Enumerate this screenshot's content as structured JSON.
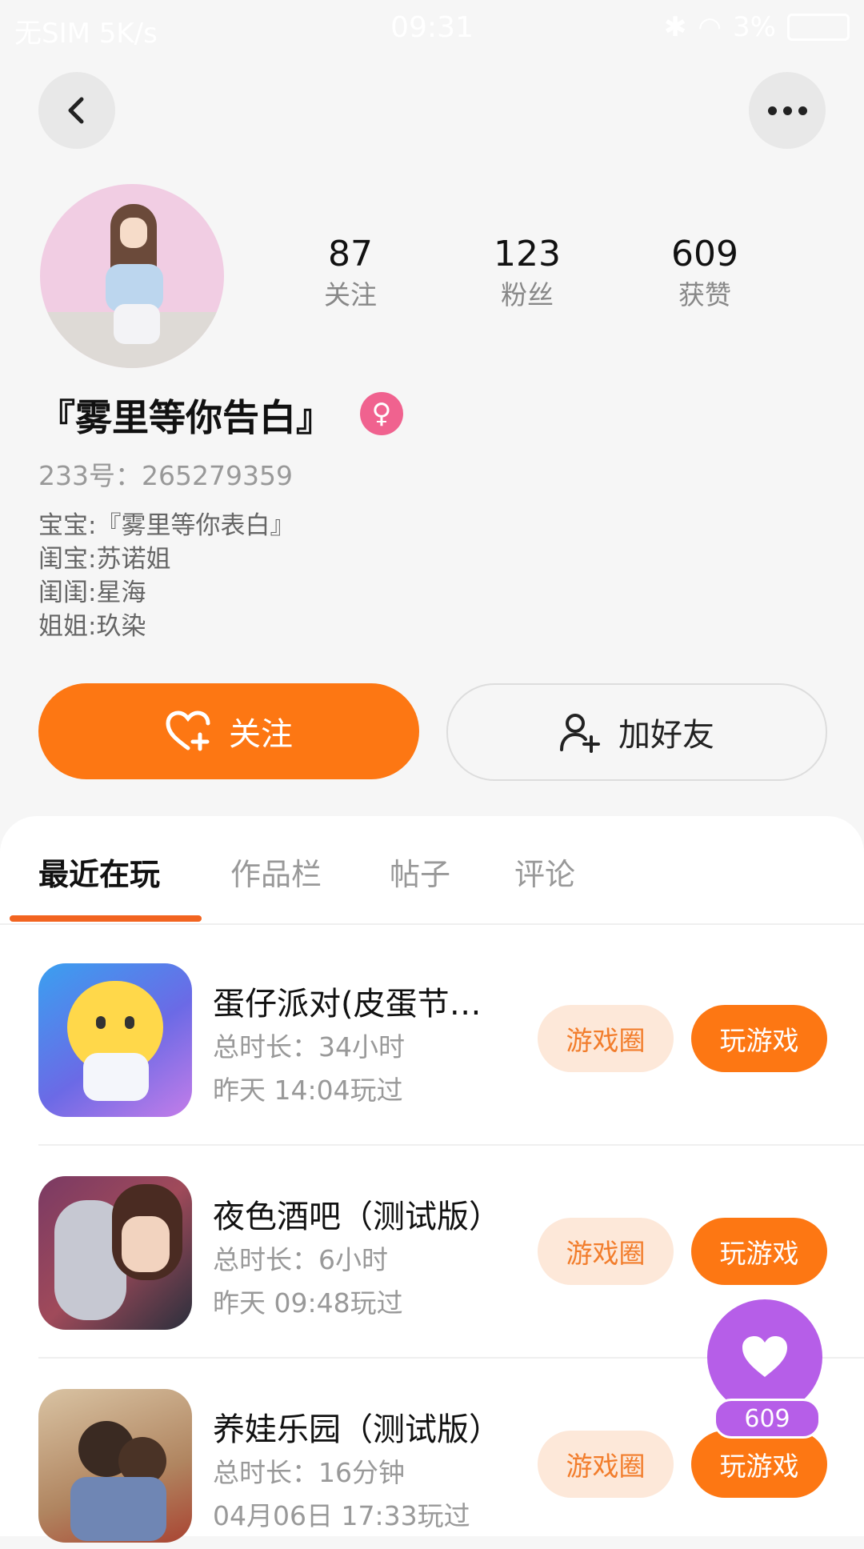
{
  "status_bar": {
    "left_text": "无SIM 5K/s",
    "time": "09:31",
    "battery": "3%"
  },
  "header": {
    "back_icon": "chevron-left-icon",
    "more_icon": "more-dots-icon"
  },
  "profile": {
    "stats": [
      {
        "value": "87",
        "label": "关注"
      },
      {
        "value": "123",
        "label": "粉丝"
      },
      {
        "value": "609",
        "label": "获赞"
      }
    ],
    "name": "『雾里等你告白』",
    "gender_symbol": "♀",
    "id_text": "233号：265279359",
    "bio_lines": [
      "宝宝:『雾里等你表白』",
      "闺宝:苏诺姐",
      "闺闺:星海",
      "姐姐:玖染"
    ]
  },
  "actions": {
    "follow_label": "关注",
    "add_friend_label": "加好友"
  },
  "tabs": [
    {
      "label": "最近在玩",
      "active": true
    },
    {
      "label": "作品栏",
      "active": false
    },
    {
      "label": "帖子",
      "active": false
    },
    {
      "label": "评论",
      "active": false
    }
  ],
  "games": [
    {
      "title": "蛋仔派对(皮蛋节…",
      "duration": "总时长：34小时",
      "last_played": "昨天 14:04玩过",
      "circle_label": "游戏圈",
      "play_label": "玩游戏"
    },
    {
      "title": "夜色酒吧（测试版）",
      "duration": "总时长：6小时",
      "last_played": "昨天 09:48玩过",
      "circle_label": "游戏圈",
      "play_label": "玩游戏"
    },
    {
      "title": "养娃乐园（测试版）",
      "duration": "总时长：16分钟",
      "last_played": "04月06日 17:33玩过",
      "circle_label": "游戏圈",
      "play_label": "玩游戏"
    }
  ],
  "like_fab": {
    "count": "609",
    "icon": "heart-icon"
  },
  "colors": {
    "accent": "#fd7713",
    "accent_light": "#fde8d9",
    "fab": "#b65ee8",
    "gender_badge": "#f0628f"
  }
}
